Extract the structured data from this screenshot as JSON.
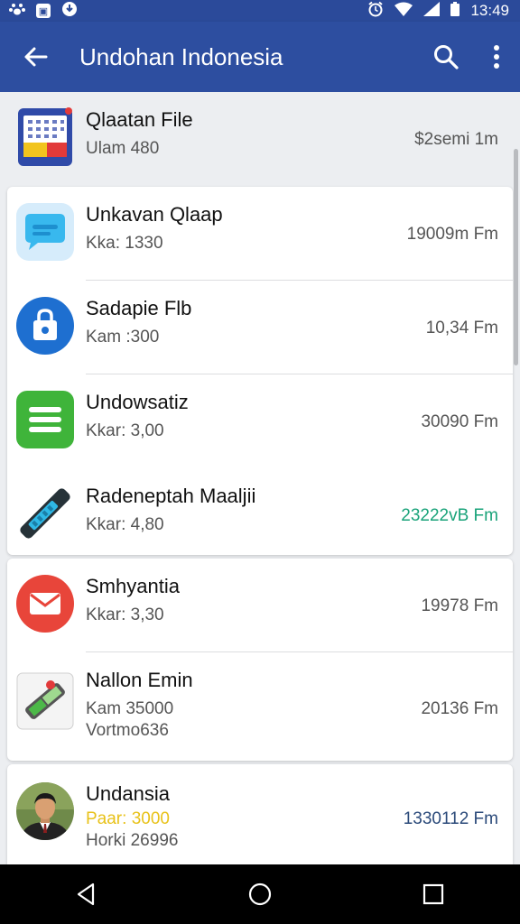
{
  "status_bar": {
    "time": "13:49",
    "left_icons": [
      "paw-notification-icon",
      "image-notification-icon",
      "download-notification-icon"
    ],
    "right_icons": [
      "alarm-icon",
      "wifi-icon",
      "signal-icon",
      "battery-icon"
    ]
  },
  "appbar": {
    "title": "Undohan Indonesia",
    "back_icon": "arrow-left-icon",
    "search_icon": "search-icon",
    "more_icon": "more-vert-icon",
    "color": "#2d4ea0"
  },
  "items": [
    {
      "name": "Qlaatan File",
      "sub": "Ulam 480",
      "meta": "$2semi 1m",
      "icon": "calendar-app-icon"
    },
    {
      "name": "Unkavan Qlaap",
      "sub": "Kka: 1330",
      "meta": "19009m Fm",
      "icon": "chat-bubble-app-icon"
    },
    {
      "name": "Sadapie Flb",
      "sub": "Kam :300",
      "meta": "10,34 Fm",
      "icon": "shopping-bag-app-icon"
    },
    {
      "name": "Undowsatiz",
      "sub": "Kkar: 3,00",
      "meta": "30090 Fm",
      "icon": "green-menu-app-icon"
    },
    {
      "name": "Radeneptah Maaljii",
      "sub": "Kkar: 4,80",
      "meta": "23222vB Fm",
      "icon": "stylus-app-icon",
      "meta_color": "#1aa37a"
    },
    {
      "name": "Smhyantia",
      "sub": "Kkar: 3,30",
      "meta": "19978 Fm",
      "icon": "mail-app-icon"
    },
    {
      "name": "Nallon Emin",
      "sub": "Kam 35000",
      "sub2": "Vortmo636",
      "meta": "20136 Fm",
      "icon": "battery-tool-app-icon"
    },
    {
      "name": "Undansia",
      "sub": "Paar: 3000",
      "sub2": "Horki 26996",
      "meta": "1330112 Fm",
      "icon": "person-avatar",
      "sub_color": "#e8c21a",
      "meta_color": "#2b4a7a"
    }
  ],
  "navbar": {
    "back_icon": "nav-back-icon",
    "home_icon": "nav-home-icon",
    "recents_icon": "nav-recents-icon"
  }
}
